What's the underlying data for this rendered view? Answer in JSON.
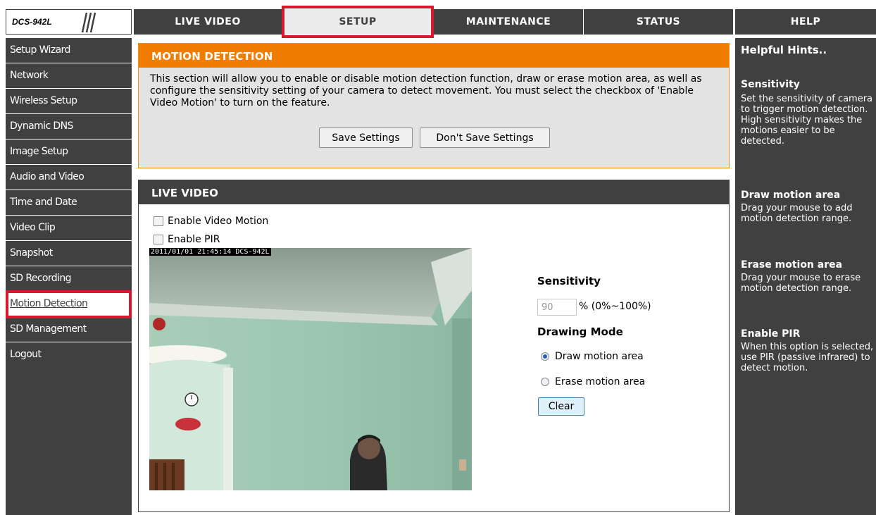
{
  "logo": {
    "model": "DCS-942L"
  },
  "nav": {
    "tabs": [
      {
        "label": "LIVE VIDEO"
      },
      {
        "label": "SETUP"
      },
      {
        "label": "MAINTENANCE"
      },
      {
        "label": "STATUS"
      },
      {
        "label": "HELP"
      }
    ],
    "active": "SETUP"
  },
  "sidebar": {
    "items": [
      {
        "label": "Setup Wizard"
      },
      {
        "label": "Network"
      },
      {
        "label": "Wireless Setup"
      },
      {
        "label": "Dynamic DNS"
      },
      {
        "label": "Image Setup"
      },
      {
        "label": "Audio and Video"
      },
      {
        "label": "Time and Date"
      },
      {
        "label": "Video Clip"
      },
      {
        "label": "Snapshot"
      },
      {
        "label": "SD Recording"
      },
      {
        "label": "Motion Detection"
      },
      {
        "label": "SD Management"
      },
      {
        "label": "Logout"
      }
    ],
    "active": "Motion Detection"
  },
  "motion": {
    "title": "MOTION DETECTION",
    "description": "This section will allow you to enable or disable motion detection function, draw or erase motion area, as well as configure the sensitivity setting of your camera to detect movement. You must select the checkbox of 'Enable Video Motion' to turn on the feature.",
    "save_label": "Save Settings",
    "dont_save_label": "Don't Save Settings"
  },
  "live": {
    "title": "LIVE VIDEO",
    "enable_motion_label": "Enable Video Motion",
    "enable_motion_checked": false,
    "enable_pir_label": "Enable PIR",
    "enable_pir_checked": false,
    "timestamp": "2011/01/01 21:45:14 DCS-942L",
    "sensitivity_label": "Sensitivity",
    "sensitivity_value": "90",
    "sensitivity_range": "% (0%~100%)",
    "drawing_mode_label": "Drawing Mode",
    "draw_label": "Draw motion area",
    "erase_label": "Erase motion area",
    "drawing_mode_selected": "Draw motion area",
    "clear_label": "Clear"
  },
  "help": {
    "title": "Helpful Hints..",
    "sections": [
      {
        "title": "Sensitivity",
        "text": "Set the sensitivity of camera to trigger motion detection. High sensitivity makes the motions easier to be detected."
      },
      {
        "title": "Draw motion area",
        "text": "Drag your mouse to add motion detection range."
      },
      {
        "title": "Erase motion area",
        "text": "Drag your mouse to erase motion detection range."
      },
      {
        "title": "Enable PIR",
        "text": "When this option is selected, use PIR (passive infrared) to detect motion."
      }
    ]
  },
  "colors": {
    "header_dark": "#404040",
    "accent_orange": "#f07c00",
    "highlight_red": "#d8182e",
    "panel_gray": "#e3e3e3"
  }
}
